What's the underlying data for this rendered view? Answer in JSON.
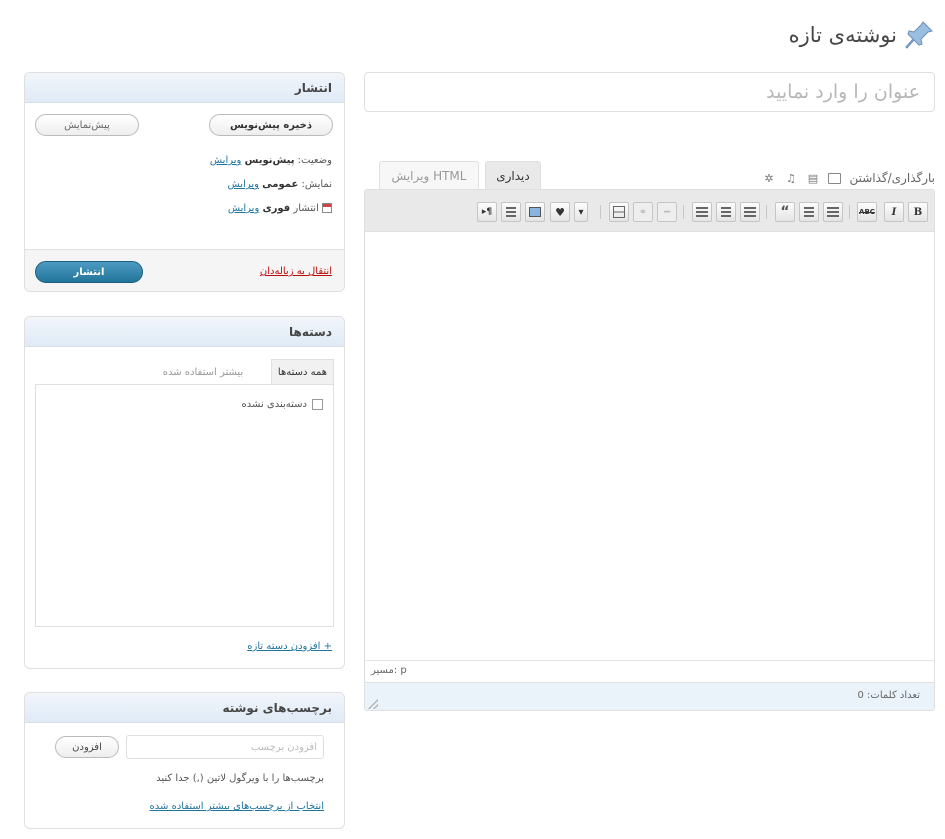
{
  "page": {
    "title": "نوشته‌ی تازه"
  },
  "post": {
    "title_placeholder": "عنوان را وارد نمایید"
  },
  "editor": {
    "upload_label": "بارگذاری/گذاشتن",
    "tabs": {
      "visual": "دیداری",
      "html": "ویرایش HTML"
    },
    "toolbar": {
      "bold": "B",
      "italic": "I",
      "strike": "ABC",
      "quote": "“",
      "more_toggle": "▾"
    },
    "path_label": "مسیر: p",
    "word_count_label": "تعداد کلمات: 0"
  },
  "publish_box": {
    "title": "انتشار",
    "save_draft": "ذخیره پیش‌نویس",
    "preview": "پیش‌نمایش",
    "status_label": "وضعیت:",
    "status_value": "پیش‌نویس",
    "status_edit": "ویرایش",
    "visibility_label": "نمایش:",
    "visibility_value": "عمومی",
    "visibility_edit": "ویرایش",
    "schedule_label": "انتشار",
    "schedule_value": "فوری",
    "schedule_edit": "ویرایش",
    "move_to_trash": "انتقال به زباله‌دان",
    "publish": "انتشار"
  },
  "categories_box": {
    "title": "دسته‌ها",
    "tab_all": "همه دسته‌ها",
    "tab_popular": "بیشتر استفاده شده",
    "items": [
      {
        "label": "دسته‌بندی نشده",
        "checked": false
      }
    ],
    "add_new": "+ افزودن دسته تازه"
  },
  "tags_box": {
    "title": "برچسب‌های نوشته",
    "input_placeholder": "افزودن برچسب",
    "add_button": "افزودن",
    "hint": "برچسب‌ها را با ویرگول لاتین (,) جدا کنید",
    "choose_popular": "انتخاب از برچسب‌های بیشتر استفاده شده"
  },
  "colors": {
    "link": "#21759b",
    "publish_button": "#21759b",
    "trash_link": "#bc0b0b",
    "box_header": "#dfeaf6"
  }
}
